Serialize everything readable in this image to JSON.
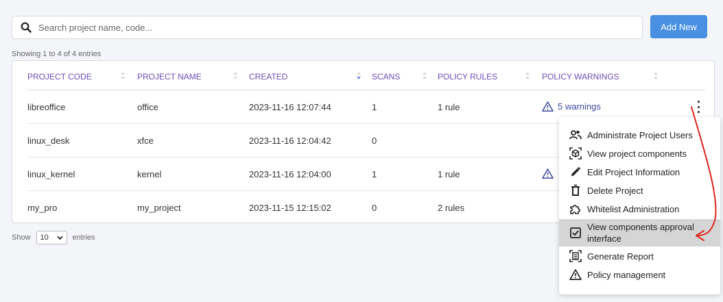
{
  "search": {
    "placeholder": "Search project name, code..."
  },
  "add_button": {
    "label": "Add New"
  },
  "showing_text": "Showing 1 to 4 of 4 entries",
  "table": {
    "columns": [
      "PROJECT CODE",
      "PROJECT NAME",
      "CREATED",
      "SCANS",
      "POLICY RULES",
      "POLICY WARNINGS"
    ],
    "rows": [
      {
        "code": "libreoffice",
        "name": "office",
        "created": "2023-11-16 12:07:44",
        "scans": "1",
        "rules": "1 rule",
        "warnings": "5 warnings"
      },
      {
        "code": "linux_desk",
        "name": "xfce",
        "created": "2023-11-16 12:04:42",
        "scans": "0",
        "rules": "",
        "warnings": ""
      },
      {
        "code": "linux_kernel",
        "name": "kernel",
        "created": "2023-11-16 12:04:00",
        "scans": "1",
        "rules": "1 rule",
        "warnings": ""
      },
      {
        "code": "my_pro",
        "name": "my_project",
        "created": "2023-11-15 12:15:02",
        "scans": "0",
        "rules": "2 rules",
        "warnings": ""
      }
    ]
  },
  "pagination": {
    "show_label": "Show",
    "page_size": "10",
    "entries_label": "entries"
  },
  "menu": {
    "items": [
      {
        "label": "Administrate Project Users",
        "icon": "users-icon"
      },
      {
        "label": "View project components",
        "icon": "components-icon"
      },
      {
        "label": "Edit Project Information",
        "icon": "pencil-icon"
      },
      {
        "label": "Delete Project",
        "icon": "trash-icon"
      },
      {
        "label": "Whitelist Administration",
        "icon": "puzzle-icon"
      },
      {
        "label": "View components approval interface",
        "icon": "checkbox-icon",
        "highlighted": true
      },
      {
        "label": "Generate Report",
        "icon": "report-icon"
      },
      {
        "label": "Policy management",
        "icon": "warning-icon"
      }
    ]
  },
  "colors": {
    "accent": "#4a90e2",
    "header_text": "#6d4bb6",
    "warning_link": "#3f4a9e",
    "annotation_arrow": "#e0241b",
    "highlight": "#d5d5d5"
  }
}
